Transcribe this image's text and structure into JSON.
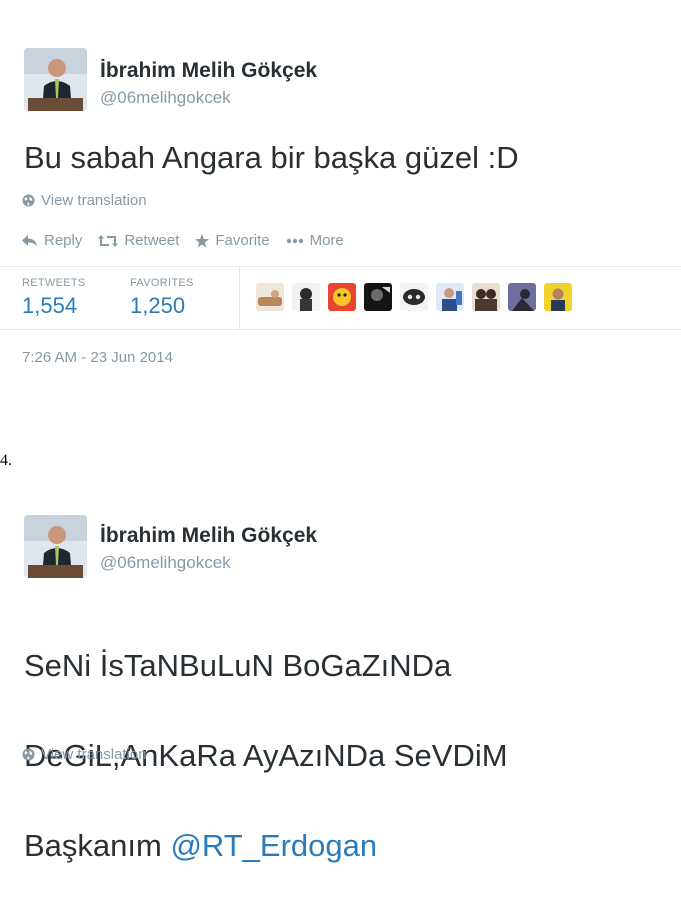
{
  "tweet1": {
    "author_name": "İbrahim Melih Gökçek",
    "author_handle": "@06melihgokcek",
    "text": "Bu sabah Angara bir başka güzel :D",
    "translation_link": "View translation",
    "actions": {
      "reply": "Reply",
      "retweet": "Retweet",
      "favorite": "Favorite",
      "more": "More"
    },
    "stats": {
      "retweets_label": "RETWEETS",
      "retweets_value": "1,554",
      "favorites_label": "FAVORITES",
      "favorites_value": "1,250"
    },
    "timestamp": "7:26 AM - 23 Jun 2014"
  },
  "stray_text": "4.",
  "tweet2": {
    "author_name": "İbrahim Melih Gökçek",
    "author_handle": "@06melihgokcek",
    "text_lines": [
      "SeNi İsTaNBuLuN BoGaZıNDa",
      "DeGiL,AnKaRa AyAzıNDa SeVDiM"
    ],
    "text_prefix": "Başkanım ",
    "mention": "@RT_Erdogan",
    "translation_link": "View translation"
  },
  "colors": {
    "text": "#292f33",
    "muted": "#8899a6",
    "link": "#2b7bb9",
    "border": "#e1e8ed"
  },
  "icons": [
    "globe-icon",
    "reply-icon",
    "retweet-icon",
    "star-icon",
    "more-icon"
  ]
}
